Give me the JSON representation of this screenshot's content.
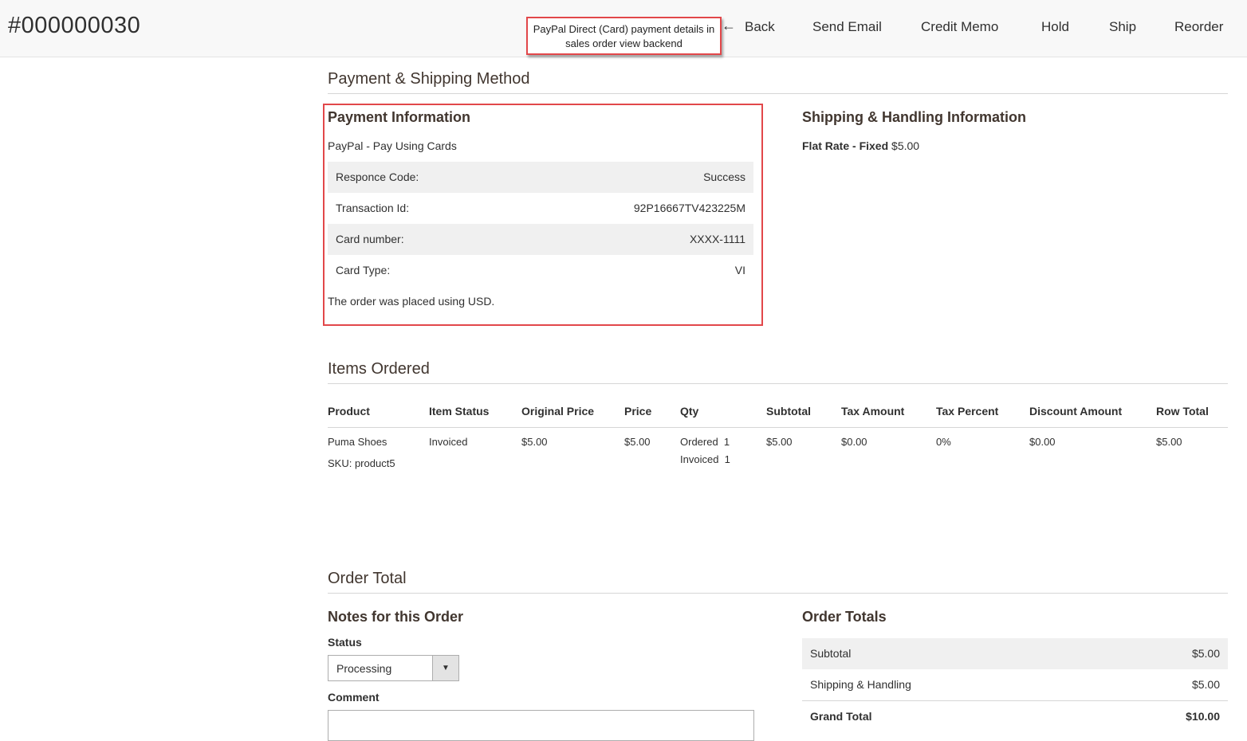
{
  "header": {
    "order_number": "#000000030",
    "annotation": "PayPal Direct (Card) payment details in sales order view backend",
    "back_arrow": "←",
    "actions": [
      "Back",
      "Send Email",
      "Credit Memo",
      "Hold",
      "Ship",
      "Reorder"
    ]
  },
  "payment_shipping": {
    "section_title": "Payment & Shipping Method",
    "payment": {
      "title": "Payment Information",
      "method": "PayPal - Pay Using Cards",
      "rows": [
        {
          "label": "Responce Code:",
          "value": "Success"
        },
        {
          "label": "Transaction Id:",
          "value": "92P16667TV423225M"
        },
        {
          "label": "Card number:",
          "value": "XXXX-1111"
        },
        {
          "label": "Card Type:",
          "value": "VI"
        }
      ],
      "currency_note": "The order was placed using USD."
    },
    "shipping": {
      "title": "Shipping & Handling Information",
      "method": "Flat Rate - Fixed",
      "price": "$5.00"
    }
  },
  "items_ordered": {
    "section_title": "Items Ordered",
    "columns": [
      "Product",
      "Item Status",
      "Original Price",
      "Price",
      "Qty",
      "Subtotal",
      "Tax Amount",
      "Tax Percent",
      "Discount Amount",
      "Row Total"
    ],
    "rows": [
      {
        "product": "Puma Shoes",
        "sku": "SKU: product5",
        "status": "Invoiced",
        "original_price": "$5.00",
        "price": "$5.00",
        "qty_ordered": "Ordered  1",
        "qty_invoiced": "Invoiced  1",
        "subtotal": "$5.00",
        "tax_amount": "$0.00",
        "tax_percent": "0%",
        "discount_amount": "$0.00",
        "row_total": "$5.00"
      }
    ]
  },
  "order_total": {
    "section_title": "Order Total",
    "notes": {
      "title": "Notes for this Order",
      "status_label": "Status",
      "status_value": "Processing",
      "comment_label": "Comment"
    },
    "totals": {
      "title": "Order Totals",
      "rows": [
        {
          "label": "Subtotal",
          "value": "$5.00"
        },
        {
          "label": "Shipping & Handling",
          "value": "$5.00"
        }
      ],
      "grand_total": {
        "label": "Grand Total",
        "value": "$10.00"
      }
    }
  },
  "colors": {
    "highlight_border": "#e2474a",
    "row_shade": "#f0f0f0",
    "header_bg": "#f8f8f8"
  }
}
